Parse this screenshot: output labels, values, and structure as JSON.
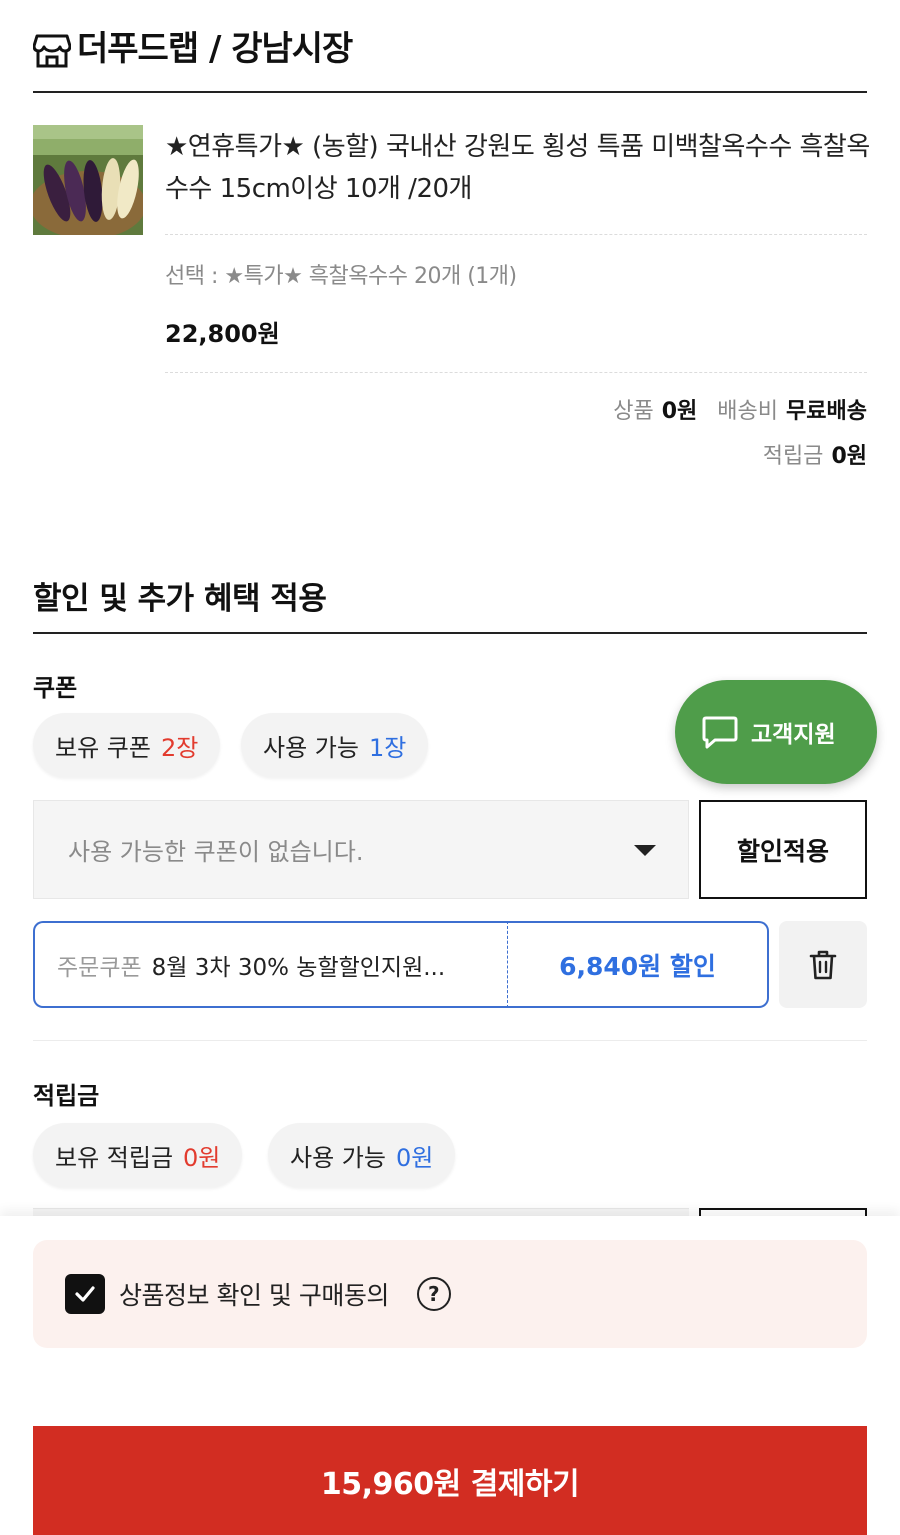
{
  "store": {
    "title": "더푸드랩 / 강남시장",
    "icon": "store-icon"
  },
  "product": {
    "name": "★연휴특가★ (농할) 국내산 강원도 횡성 특품 미백찰옥수수 흑찰옥수수 15cm이상 10개 /20개",
    "option": "선택 : ★특가★ 흑찰옥수수 20개 (1개)",
    "price": "22,800원",
    "summary": {
      "product_label": "상품",
      "product_value": "0원",
      "shipping_label": "배송비",
      "shipping_value": "무료배송",
      "points_label": "적립금",
      "points_value": "0원"
    }
  },
  "benefits": {
    "title": "할인 및 추가 혜택 적용",
    "coupon": {
      "label": "쿠폰",
      "owned_label": "보유 쿠폰",
      "owned_value": "2장",
      "usable_label": "사용 가능",
      "usable_value": "1장",
      "select_placeholder": "사용 가능한 쿠폰이 없습니다.",
      "apply_label": "할인적용",
      "applied": {
        "tag": "주문쿠폰",
        "name": "8월 3차 30% 농할할인지원...",
        "discount": "6,840원 할인"
      }
    },
    "points": {
      "label": "적립금",
      "owned_label": "보유 적립금",
      "owned_value": "0원",
      "usable_label": "사용 가능",
      "usable_value": "0원"
    }
  },
  "support": {
    "label": "고객지원",
    "icon": "chat-icon"
  },
  "agreement": {
    "text": "상품정보 확인 및 구매동의",
    "checked": true
  },
  "pay_button": "15,960원 결제하기",
  "colors": {
    "accent_red": "#d22d22",
    "highlight_red": "#e23b2e",
    "blue": "#2f6fe0",
    "support_green": "#4f9d4a",
    "agree_bg": "#fcf1ee"
  }
}
